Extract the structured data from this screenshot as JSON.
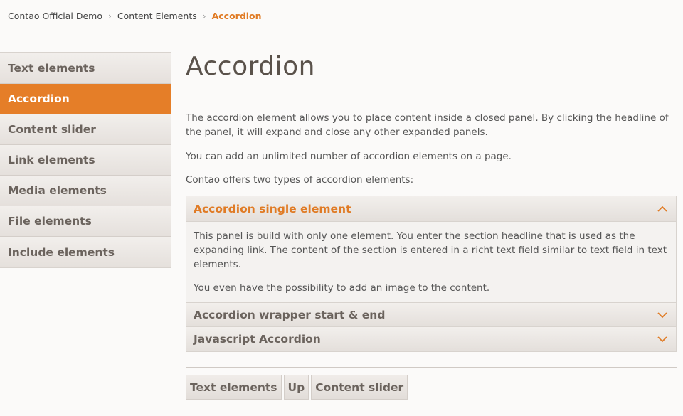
{
  "breadcrumb": {
    "items": [
      "Contao Official Demo",
      "Content Elements"
    ],
    "current": "Accordion"
  },
  "sidebar": {
    "items": [
      {
        "label": "Text elements"
      },
      {
        "label": "Accordion"
      },
      {
        "label": "Content slider"
      },
      {
        "label": "Link elements"
      },
      {
        "label": "Media elements"
      },
      {
        "label": "File elements"
      },
      {
        "label": "Include elements"
      }
    ]
  },
  "main": {
    "title": "Accordion",
    "paragraphs": [
      "The accordion element allows you to place content inside a closed panel. By clicking the headline of the panel, it will expand and close any other expanded panels.",
      "You can add an unlimited number of accordion elements on a page.",
      "Contao offers two types of accordion elements:"
    ]
  },
  "accordion": {
    "panels": [
      {
        "title": "Accordion single element",
        "open": true,
        "content": [
          "This panel is build with only one element. You enter the section headline that is used as the expanding link. The content of the section is entered in a richt text field similar to text field in text elements.",
          "You even have the possibility to add an image to the content."
        ]
      },
      {
        "title": "Accordion wrapper start & end",
        "open": false
      },
      {
        "title": "Javascript Accordion",
        "open": false
      }
    ]
  },
  "pager": {
    "prev": "Text elements",
    "up": "Up",
    "next": "Content slider"
  },
  "colors": {
    "accent": "#e57e28",
    "text": "#555555",
    "background": "#fbfaf9"
  }
}
